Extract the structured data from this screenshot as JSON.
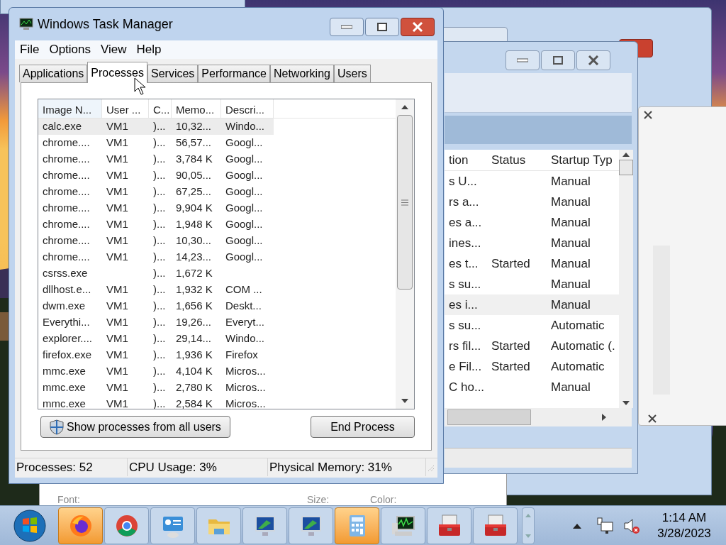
{
  "task_manager": {
    "title": "Windows Task Manager",
    "menu": [
      "File",
      "Options",
      "View",
      "Help"
    ],
    "tabs": [
      {
        "label": "Applications",
        "selected": false
      },
      {
        "label": "Processes",
        "selected": true
      },
      {
        "label": "Services",
        "selected": false
      },
      {
        "label": "Performance",
        "selected": false
      },
      {
        "label": "Networking",
        "selected": false
      },
      {
        "label": "Users",
        "selected": false
      }
    ],
    "table": {
      "columns": [
        "Image N...",
        "User ...",
        "C...",
        "Memo...",
        "Descri..."
      ],
      "rows": [
        {
          "cells": [
            "calc.exe",
            "VM1",
            ")...",
            "10,32...",
            "Windo..."
          ],
          "selected": true
        },
        {
          "cells": [
            "chrome....",
            "VM1",
            ")...",
            "56,57...",
            "Googl..."
          ],
          "selected": false
        },
        {
          "cells": [
            "chrome....",
            "VM1",
            ")...",
            "3,784 K",
            "Googl..."
          ],
          "selected": false
        },
        {
          "cells": [
            "chrome....",
            "VM1",
            ")...",
            "90,05...",
            "Googl..."
          ],
          "selected": false
        },
        {
          "cells": [
            "chrome....",
            "VM1",
            ")...",
            "67,25...",
            "Googl..."
          ],
          "selected": false
        },
        {
          "cells": [
            "chrome....",
            "VM1",
            ")...",
            "9,904 K",
            "Googl..."
          ],
          "selected": false
        },
        {
          "cells": [
            "chrome....",
            "VM1",
            ")...",
            "1,948 K",
            "Googl..."
          ],
          "selected": false
        },
        {
          "cells": [
            "chrome....",
            "VM1",
            ")...",
            "10,30...",
            "Googl..."
          ],
          "selected": false
        },
        {
          "cells": [
            "chrome....",
            "VM1",
            ")...",
            "14,23...",
            "Googl..."
          ],
          "selected": false
        },
        {
          "cells": [
            "csrss.exe",
            "",
            ")...",
            "1,672 K",
            ""
          ],
          "selected": false
        },
        {
          "cells": [
            "dllhost.e...",
            "VM1",
            ")...",
            "1,932 K",
            "COM ..."
          ],
          "selected": false
        },
        {
          "cells": [
            "dwm.exe",
            "VM1",
            ")...",
            "1,656 K",
            "Deskt..."
          ],
          "selected": false
        },
        {
          "cells": [
            "Everythi...",
            "VM1",
            ")...",
            "19,26...",
            "Everyt..."
          ],
          "selected": false
        },
        {
          "cells": [
            "explorer....",
            "VM1",
            ")...",
            "29,14...",
            "Windo..."
          ],
          "selected": false
        },
        {
          "cells": [
            "firefox.exe",
            "VM1",
            ")...",
            "1,936 K",
            "Firefox"
          ],
          "selected": false
        },
        {
          "cells": [
            "mmc.exe",
            "VM1",
            ")...",
            "4,104 K",
            "Micros..."
          ],
          "selected": false
        },
        {
          "cells": [
            "mmc.exe",
            "VM1",
            ")...",
            "2,780 K",
            "Micros..."
          ],
          "selected": false
        },
        {
          "cells": [
            "mmc.exe",
            "VM1",
            ")...",
            "2,584 K",
            "Micros..."
          ],
          "selected": false
        }
      ]
    },
    "show_all_button": "Show processes from all users",
    "end_button": "End Process",
    "status_bar": [
      "Processes: 52",
      "CPU Usage: 3%",
      "Physical Memory: 31%"
    ]
  },
  "services_window": {
    "columns": [
      "tion",
      "Status",
      "Startup Typ"
    ],
    "rows": [
      {
        "cells": [
          "s U...",
          "",
          "Manual"
        ],
        "selected": false
      },
      {
        "cells": [
          "rs a...",
          "",
          "Manual"
        ],
        "selected": false
      },
      {
        "cells": [
          "es a...",
          "",
          "Manual"
        ],
        "selected": false
      },
      {
        "cells": [
          "ines...",
          "",
          "Manual"
        ],
        "selected": false
      },
      {
        "cells": [
          "es t...",
          "Started",
          "Manual"
        ],
        "selected": false
      },
      {
        "cells": [
          "s su...",
          "",
          "Manual"
        ],
        "selected": false
      },
      {
        "cells": [
          "es i...",
          "",
          "Manual"
        ],
        "selected": true
      },
      {
        "cells": [
          "s su...",
          "",
          "Automatic"
        ],
        "selected": false
      },
      {
        "cells": [
          "rs fil...",
          "Started",
          "Automatic (."
        ],
        "selected": false
      },
      {
        "cells": [
          "e Fil...",
          "Started",
          "Automatic"
        ],
        "selected": false
      },
      {
        "cells": [
          "C ho...",
          "",
          "Manual"
        ],
        "selected": false
      }
    ]
  },
  "font_window": {
    "labels": [
      "Font:",
      "Size:",
      "Color:"
    ]
  },
  "taskbar": {
    "apps": [
      {
        "kind": "firefox",
        "highlighted": true
      },
      {
        "kind": "chrome",
        "highlighted": false
      },
      {
        "kind": "control",
        "highlighted": false
      },
      {
        "kind": "folder",
        "highlighted": false
      },
      {
        "kind": "monitor",
        "highlighted": false
      },
      {
        "kind": "monitor2",
        "highlighted": false
      },
      {
        "kind": "calculator",
        "highlighted": true
      },
      {
        "kind": "perf",
        "highlighted": false
      },
      {
        "kind": "toolbox",
        "highlighted": false
      },
      {
        "kind": "toolbox",
        "highlighted": false
      }
    ],
    "time": "1:14 AM",
    "date": "3/28/2023"
  }
}
